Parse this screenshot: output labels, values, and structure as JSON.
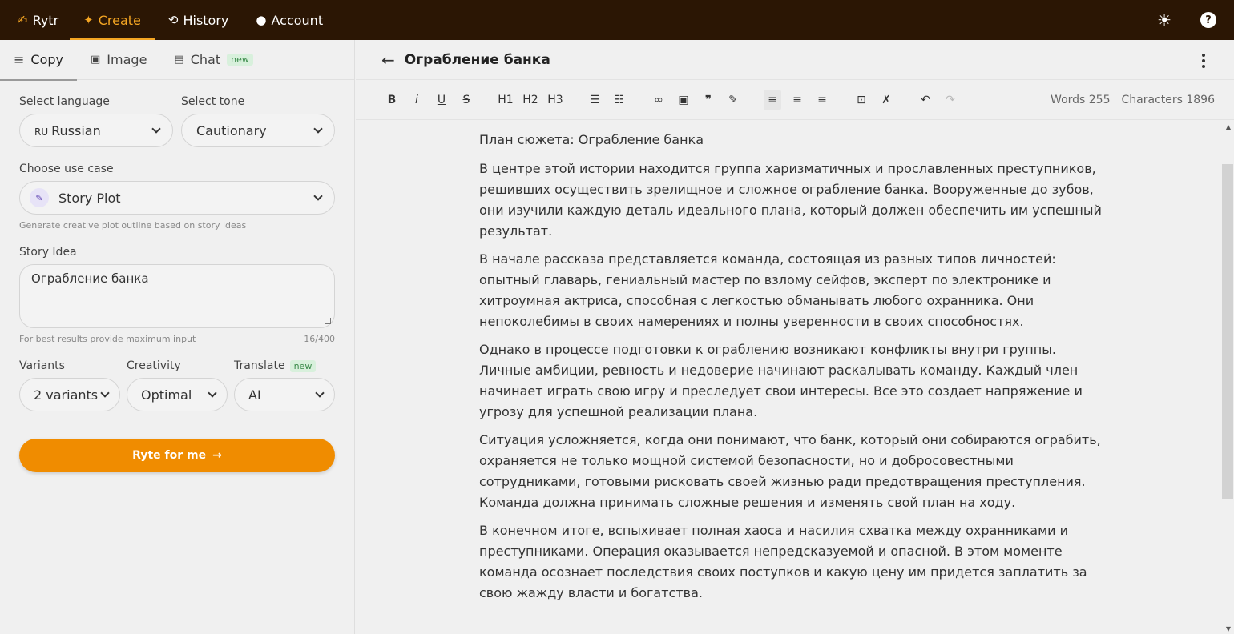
{
  "topnav": {
    "brand": "Rytr",
    "items": [
      {
        "label": "Create",
        "icon": "sparkle-icon",
        "active": true
      },
      {
        "label": "History",
        "icon": "history-icon",
        "active": false
      },
      {
        "label": "Account",
        "icon": "user-icon",
        "active": false
      }
    ],
    "right_icons": [
      "sun-icon",
      "help-icon"
    ]
  },
  "left": {
    "tabs": [
      {
        "label": "Copy",
        "active": true
      },
      {
        "label": "Image",
        "active": false
      },
      {
        "label": "Chat",
        "badge": "new",
        "active": false
      }
    ],
    "language_label": "Select language",
    "language_code": "RU",
    "language_value": "Russian",
    "tone_label": "Select tone",
    "tone_value": "Cautionary",
    "usecase_label": "Choose use case",
    "usecase_value": "Story Plot",
    "usecase_hint": "Generate creative plot outline based on story ideas",
    "idea_label": "Story Idea",
    "idea_value": "Ограбление банка",
    "idea_hint": "For best results provide maximum input",
    "idea_count": "16/400",
    "variants_label": "Variants",
    "variants_value": "2 variants",
    "creativity_label": "Creativity",
    "creativity_value": "Optimal",
    "translate_label": "Translate",
    "translate_badge": "new",
    "translate_value": "AI",
    "cta_label": "Ryte for me",
    "accent_color": "#f08c00"
  },
  "editor": {
    "title": "Ограбление банка",
    "toolbar": [
      "B",
      "i",
      "U",
      "S",
      "H1",
      "H2",
      "H3"
    ],
    "words_label": "Words 255",
    "chars_label": "Characters 1896",
    "paragraphs": [
      "План сюжета: Ограбление банка",
      "В центре этой истории находится группа харизматичных и прославленных преступников, решивших осуществить зрелищное и сложное ограбление банка. Вооруженные до зубов, они изучили каждую деталь идеального плана, который должен обеспечить им успешный результат.",
      "В начале рассказа представляется команда, состоящая из разных типов личностей: опытный главарь, гениальный мастер по взлому сейфов, эксперт по электронике и хитроумная актриса, способная с легкостью обманывать любого охранника. Они непоколебимы в своих намерениях и полны уверенности в своих способностях.",
      "Однако в процессе подготовки к ограблению возникают конфликты внутри группы. Личные амбиции, ревность и недоверие начинают раскалывать команду. Каждый член начинает играть свою игру и преследует свои интересы. Все это создает напряжение и угрозу для успешной реализации плана.",
      "Ситуация усложняется, когда они понимают, что банк, который они собираются ограбить, охраняется не только мощной системой безопасности, но и добросовестными сотрудниками, готовыми рисковать своей жизнью ради предотвращения преступления. Команда должна принимать сложные решения и изменять свой план на ходу.",
      "В конечном итоге, вспыхивает полная хаоса и насилия схватка между охранниками и преступниками. Операция оказывается непредсказуемой и опасной. В этом моменте команда осознает последствия своих поступков и какую цену им придется заплатить за свою жажду власти и богатства."
    ]
  }
}
